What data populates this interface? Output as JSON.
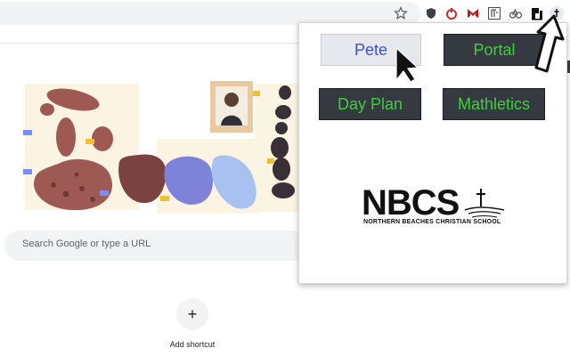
{
  "search": {
    "placeholder": "Search Google or type a URL"
  },
  "shortcut": {
    "icon_glyph": "+",
    "label": "Add shortcut"
  },
  "extensions": [
    {
      "name": "shield-extension-icon"
    },
    {
      "name": "lastpass-extension-icon"
    },
    {
      "name": "mcafee-extension-icon"
    },
    {
      "name": "mathletics-extension-icon"
    },
    {
      "name": "link-extension-icon"
    },
    {
      "name": "pi-extension-icon"
    },
    {
      "name": "nbcs-extension-icon"
    }
  ],
  "popup": {
    "buttons": [
      {
        "label": "Pete",
        "style": "light"
      },
      {
        "label": "Portal",
        "style": "dark"
      },
      {
        "label": "Day Plan",
        "style": "dark"
      },
      {
        "label": "Mathletics",
        "style": "dark"
      }
    ],
    "logo": {
      "title": "NBCS",
      "subtitle": "NORTHERN BEACHES CHRISTIAN SCHOOL"
    }
  },
  "colors": {
    "button_light_bg": "#e6e8ed",
    "button_light_text": "#3f52c8",
    "button_dark_bg": "#343a40",
    "button_dark_text": "#3ecf3e"
  }
}
